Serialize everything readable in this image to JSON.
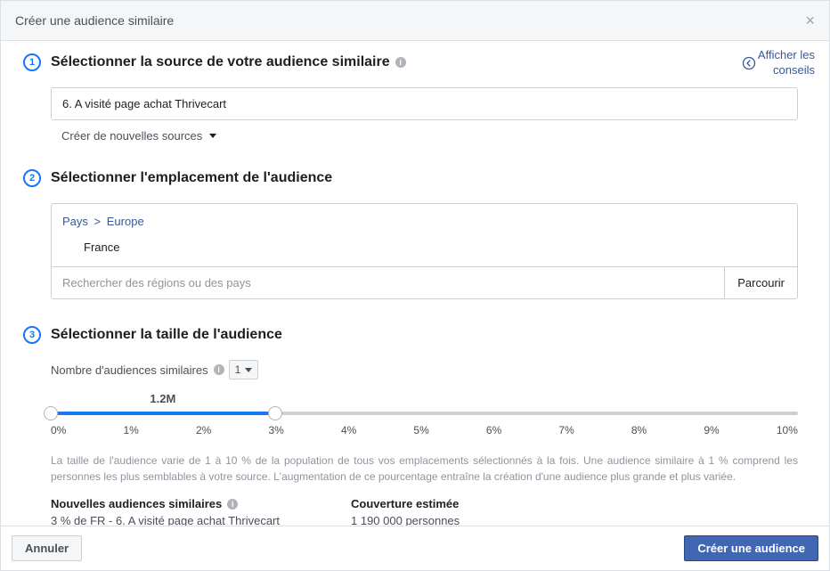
{
  "header": {
    "title": "Créer une audience similaire"
  },
  "tips": {
    "line1": "Afficher les",
    "line2": "conseils"
  },
  "step1": {
    "num": "1",
    "title": "Sélectionner la source de votre audience similaire",
    "selected_source": "6. A visité page achat Thrivecart",
    "new_sources_label": "Créer de nouvelles sources"
  },
  "step2": {
    "num": "2",
    "title": "Sélectionner l'emplacement de l'audience",
    "breadcrumb_root": "Pays",
    "breadcrumb_sep": ">",
    "breadcrumb_current": "Europe",
    "selected_location": "France",
    "search_placeholder": "Rechercher des régions ou des pays",
    "browse_label": "Parcourir"
  },
  "step3": {
    "num": "3",
    "title": "Sélectionner la taille de l'audience",
    "count_label": "Nombre d'audiences similaires",
    "count_value": "1",
    "size_label": "1.2M",
    "slider_ticks": [
      "0%",
      "1%",
      "2%",
      "3%",
      "4%",
      "5%",
      "6%",
      "7%",
      "8%",
      "9%",
      "10%"
    ],
    "slider_start_percent": 0,
    "slider_end_percent": 30,
    "desc": "La taille de l'audience varie de 1 à 10 % de la population de tous vos emplacements sélectionnés à la fois. Une audience similaire à 1 % comprend les personnes les plus semblables à votre source. L'augmentation de ce pourcentage entraîne la création d'une audience plus grande et plus variée.",
    "new_lal_head": "Nouvelles audiences similaires",
    "new_lal_value": "3 % de FR - 6. A visité page achat Thrivecart",
    "reach_head": "Couverture estimée",
    "reach_value": "1 190 000 personnes"
  },
  "footer": {
    "cancel": "Annuler",
    "create": "Créer une audience"
  }
}
